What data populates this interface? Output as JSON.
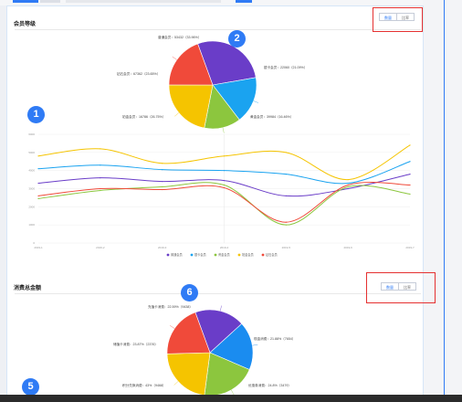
{
  "colors": {
    "accent": "#2f7bf5",
    "highlight_box": "#e53030",
    "series": [
      "#6a3dc8",
      "#1aa3f0",
      "#8cc63e",
      "#f5c400",
      "#f04a3a"
    ]
  },
  "section1": {
    "title": "会员等级",
    "toggle": [
      "数量",
      "比率"
    ]
  },
  "pie1": {
    "slices": [
      {
        "label": "普通会员：53432（33.96%）",
        "value": 33.96,
        "color": "#6a3dc8"
      },
      {
        "label": "银卡会员：22060（21.09%）",
        "value": 21.09,
        "color": "#1aa3f0"
      },
      {
        "label": "黄金会员：39984（16.46%）",
        "value": 16.46,
        "color": "#8cc63e"
      },
      {
        "label": "铂金会员：16786（26.75%）",
        "value": 26.75,
        "color": "#f5c400"
      },
      {
        "label": "钻石会员：67362（23.65%）",
        "value": 23.65,
        "color": "#f04a3a"
      }
    ]
  },
  "chart_data": {
    "type": "line",
    "categories": [
      "2019-1",
      "2019-2",
      "2019-3",
      "2019-4",
      "2019-5",
      "2019-6",
      "2019-7"
    ],
    "ylim": [
      0,
      6000
    ],
    "yticks": [
      0,
      1000,
      2000,
      3000,
      4000,
      5000,
      6000
    ],
    "series": [
      {
        "name": "普通会员",
        "color": "#6a3dc8",
        "values": [
          3300,
          3600,
          3400,
          3450,
          2600,
          3000,
          3800
        ]
      },
      {
        "name": "银卡会员",
        "color": "#1aa3f0",
        "values": [
          4100,
          4300,
          4050,
          4000,
          3800,
          3300,
          4500
        ]
      },
      {
        "name": "黄金会员",
        "color": "#8cc63e",
        "values": [
          2450,
          2900,
          3100,
          3200,
          1000,
          3100,
          2700
        ]
      },
      {
        "name": "铂金会员",
        "color": "#f5c400",
        "values": [
          4800,
          5200,
          4400,
          4800,
          5000,
          3500,
          5400
        ]
      },
      {
        "name": "钻石会员",
        "color": "#f04a3a",
        "values": [
          2600,
          3000,
          2950,
          3050,
          1150,
          3200,
          3200
        ]
      }
    ]
  },
  "section2": {
    "title": "消费总金额",
    "toggle": [
      "数量",
      "比率"
    ]
  },
  "pie2": {
    "slices": [
      {
        "label": "充值卡消费：22.59%（9438）",
        "value": 22.59,
        "color": "#6a3dc8"
      },
      {
        "label": "现金消费：21.88%（7654）",
        "value": 21.88,
        "color": "#1a8cf0"
      },
      {
        "label": "优惠券消费：24.8%（3479）",
        "value": 24.8,
        "color": "#8cc63e"
      },
      {
        "label": "积分兑换消费：43%（9468）",
        "value": 27.0,
        "color": "#f5c400"
      },
      {
        "label": "储值卡消费：23.87%（2376）",
        "value": 23.87,
        "color": "#f04a3a"
      }
    ]
  },
  "badges": [
    "1",
    "2",
    "5",
    "6"
  ]
}
